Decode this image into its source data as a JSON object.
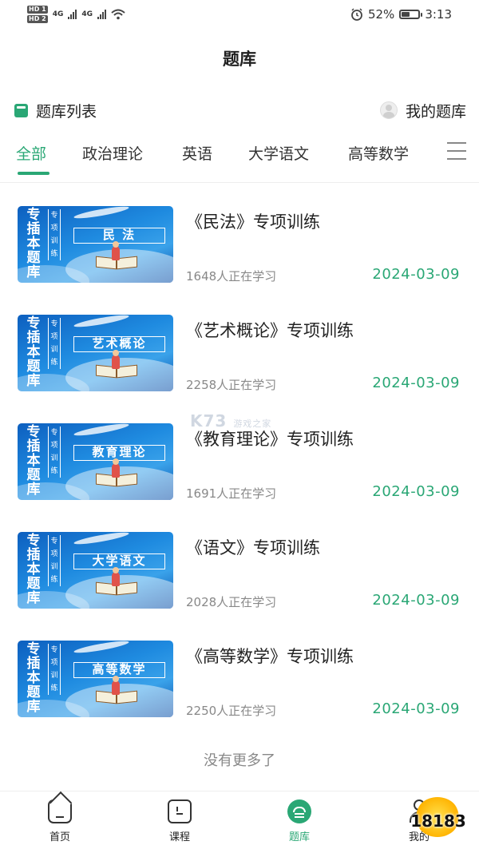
{
  "status_bar": {
    "sim1": "HD 1",
    "sim2": "HD 2",
    "net1": "4G",
    "net2": "4G",
    "battery_percent": "52%",
    "battery_level": 0.52,
    "time": "3:13"
  },
  "header": {
    "title": "题库"
  },
  "subheader": {
    "list_label": "题库列表",
    "my_bank_label": "我的题库"
  },
  "tabs": [
    {
      "label": "全部",
      "active": true
    },
    {
      "label": "政治理论",
      "active": false
    },
    {
      "label": "英语",
      "active": false
    },
    {
      "label": "大学语文",
      "active": false
    },
    {
      "label": "高等数学",
      "active": false
    }
  ],
  "thumbnail_text": {
    "vertical_main": "专插本题库",
    "vertical_sub": "专项训练"
  },
  "items": [
    {
      "thumb_label": "民 法",
      "title": "《民法》专项训练",
      "learners": "1648人正在学习",
      "date": "2024-03-09"
    },
    {
      "thumb_label": "艺术概论",
      "title": "《艺术概论》专项训练",
      "learners": "2258人正在学习",
      "date": "2024-03-09"
    },
    {
      "thumb_label": "教育理论",
      "title": "《教育理论》专项训练",
      "learners": "1691人正在学习",
      "date": "2024-03-09"
    },
    {
      "thumb_label": "大学语文",
      "title": "《语文》专项训练",
      "learners": "2028人正在学习",
      "date": "2024-03-09"
    },
    {
      "thumb_label": "高等数学",
      "title": "《高等数学》专项训练",
      "learners": "2250人正在学习",
      "date": "2024-03-09"
    }
  ],
  "no_more_text": "没有更多了",
  "bottom_nav": [
    {
      "label": "首页",
      "icon": "home-icon",
      "active": false
    },
    {
      "label": "课程",
      "icon": "course-icon",
      "active": false
    },
    {
      "label": "题库",
      "icon": "question-bank-icon",
      "active": true
    },
    {
      "label": "我的",
      "icon": "profile-icon",
      "active": false
    }
  ],
  "watermarks": {
    "center": "K73",
    "center_sub": "游戏之家",
    "corner": "18183"
  },
  "colors": {
    "accent": "#2aa775",
    "text": "#222222",
    "muted": "#888888"
  }
}
